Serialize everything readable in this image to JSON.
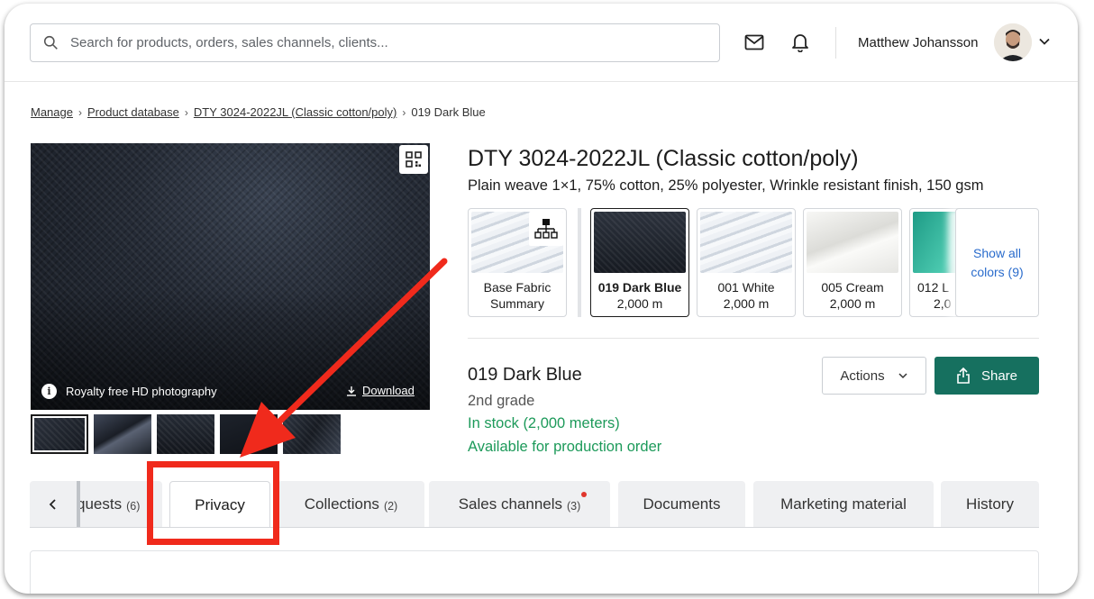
{
  "header": {
    "search_placeholder": "Search for products, orders, sales channels, clients...",
    "user_name": "Matthew Johansson"
  },
  "breadcrumb": {
    "items": [
      "Manage",
      "Product database",
      "DTY 3024-2022JL (Classic cotton/poly)"
    ],
    "current": "019 Dark Blue"
  },
  "gallery": {
    "info_text": "Royalty free HD photography",
    "download_label": "Download"
  },
  "product": {
    "title": "DTY 3024-2022JL (Classic cotton/poly)",
    "subtitle": "Plain weave 1×1, 75% cotton, 25% polyester, Wrinkle resistant finish, 150 gsm"
  },
  "swatches": [
    {
      "name": "Base Fabric",
      "detail": "Summary"
    },
    {
      "name": "019 Dark Blue",
      "detail": "2,000 m"
    },
    {
      "name": "001 White",
      "detail": "2,000 m"
    },
    {
      "name": "005 Cream",
      "detail": "2,000 m"
    },
    {
      "name": "012 L",
      "detail": "2,0"
    }
  ],
  "show_all": {
    "line1": "Show all",
    "line2": "colors (9)"
  },
  "variant": {
    "name": "019 Dark Blue",
    "grade": "2nd grade",
    "stock": "In stock (2,000 meters)",
    "availability": "Available for production order"
  },
  "buttons": {
    "actions": "Actions",
    "share": "Share"
  },
  "tabs": [
    {
      "label": "quests",
      "count": "(6)"
    },
    {
      "label": "Privacy",
      "count": ""
    },
    {
      "label": "Collections",
      "count": "(2)"
    },
    {
      "label": "Sales channels",
      "count": "(3)"
    },
    {
      "label": "Documents",
      "count": ""
    },
    {
      "label": "Marketing material",
      "count": ""
    },
    {
      "label": "History",
      "count": ""
    }
  ],
  "colors": {
    "accent_green": "#16705f",
    "stock_green": "#1d9a5a",
    "link_blue": "#2a6ccc",
    "annotation_red": "#f02a1c"
  }
}
